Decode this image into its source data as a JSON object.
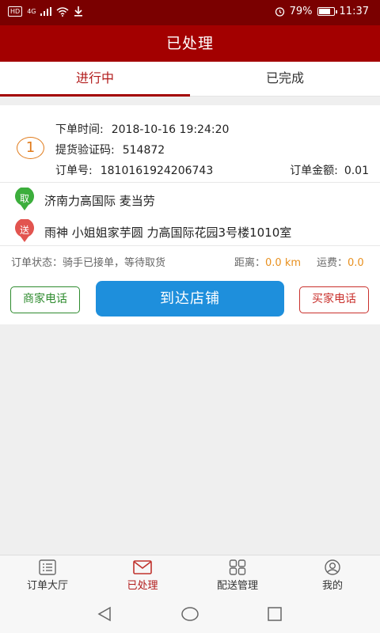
{
  "status_bar": {
    "badge": "HD",
    "network": "4G",
    "battery_text": "79%",
    "battery_level": 0.79,
    "time": "11:37"
  },
  "header": {
    "title": "已处理"
  },
  "tabs": [
    {
      "label": "进行中",
      "active": true
    },
    {
      "label": "已完成",
      "active": false
    }
  ],
  "order": {
    "index": "1",
    "order_time_label": "下单时间:",
    "order_time": "2018-10-16 19:24:20",
    "pickup_code_label": "提货验证码:",
    "pickup_code": "514872",
    "order_no_label": "订单号:",
    "order_no": "1810161924206743",
    "amount_label": "订单金额:",
    "amount": "0.01",
    "pickup_tag": "取",
    "pickup_address": "济南力高国际 麦当劳",
    "delivery_tag": "送",
    "delivery_address": "雨神 小姐姐家芋圆 力高国际花园3号楼1010室",
    "status_text": "订单状态：骑手已接单，等待取货",
    "distance_label": "距离：",
    "distance_value": "0.0 km",
    "fee_label": "运费：",
    "fee_value": "0.0"
  },
  "actions": {
    "shop_phone": "商家电话",
    "arrive_store": "到达店铺",
    "buyer_phone": "买家电话"
  },
  "bottom_nav": [
    {
      "label": "订单大厅",
      "icon": "list-icon",
      "active": false
    },
    {
      "label": "已处理",
      "icon": "mail-icon",
      "active": true
    },
    {
      "label": "配送管理",
      "icon": "grid-icon",
      "active": false
    },
    {
      "label": "我的",
      "icon": "profile-icon",
      "active": false
    }
  ],
  "colors": {
    "brand_red": "#a30000",
    "status_bar": "#7a0000",
    "accent_blue": "#1e8fdc",
    "green": "#2e8b2e",
    "orange": "#e8901f"
  }
}
